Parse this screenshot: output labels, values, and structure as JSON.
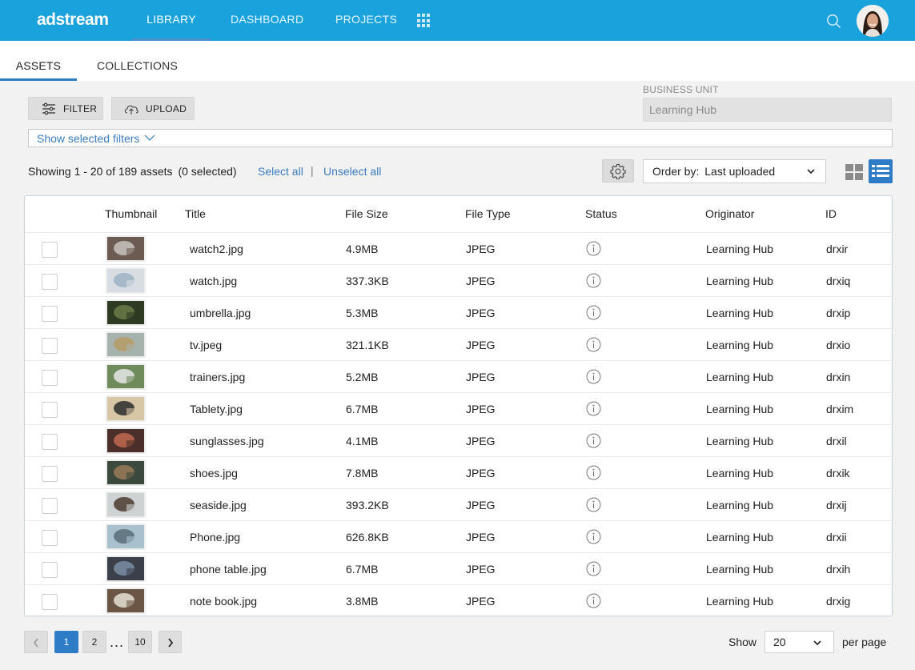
{
  "header": {
    "logo": "adstream",
    "nav": [
      "LIBRARY",
      "DASHBOARD",
      "PROJECTS"
    ],
    "active_nav": "LIBRARY"
  },
  "subtabs": [
    "ASSETS",
    "COLLECTIONS"
  ],
  "toolbar": {
    "filter_label": "FILTER",
    "upload_label": "UPLOAD",
    "business_unit_label": "BUSINESS UNIT",
    "business_unit_value": "Learning Hub",
    "show_filters_label": "Show selected filters"
  },
  "results": {
    "showing": "Showing 1 - 20 of 189 assets",
    "selected": "(0 selected)",
    "select_all": "Select all",
    "separator": "|",
    "unselect_all": "Unselect all",
    "order_by_label": "Order by:",
    "order_by_value": "Last uploaded"
  },
  "table": {
    "columns": [
      "Thumbnail",
      "Title",
      "File Size",
      "File Type",
      "Status",
      "Originator",
      "ID"
    ],
    "rows": [
      {
        "title": "watch2.jpg",
        "size": "4.9MB",
        "type": "JPEG",
        "originator": "Learning Hub",
        "id": "drxir"
      },
      {
        "title": "watch.jpg",
        "size": "337.3KB",
        "type": "JPEG",
        "originator": "Learning Hub",
        "id": "drxiq"
      },
      {
        "title": "umbrella.jpg",
        "size": "5.3MB",
        "type": "JPEG",
        "originator": "Learning Hub",
        "id": "drxip"
      },
      {
        "title": "tv.jpeg",
        "size": "321.1KB",
        "type": "JPEG",
        "originator": "Learning Hub",
        "id": "drxio"
      },
      {
        "title": "trainers.jpg",
        "size": "5.2MB",
        "type": "JPEG",
        "originator": "Learning Hub",
        "id": "drxin"
      },
      {
        "title": "Tablety.jpg",
        "size": "6.7MB",
        "type": "JPEG",
        "originator": "Learning Hub",
        "id": "drxim"
      },
      {
        "title": "sunglasses.jpg",
        "size": "4.1MB",
        "type": "JPEG",
        "originator": "Learning Hub",
        "id": "drxil"
      },
      {
        "title": "shoes.jpg",
        "size": "7.8MB",
        "type": "JPEG",
        "originator": "Learning Hub",
        "id": "drxik"
      },
      {
        "title": "seaside.jpg",
        "size": "393.2KB",
        "type": "JPEG",
        "originator": "Learning Hub",
        "id": "drxij"
      },
      {
        "title": "Phone.jpg",
        "size": "626.8KB",
        "type": "JPEG",
        "originator": "Learning Hub",
        "id": "drxii"
      },
      {
        "title": "phone table.jpg",
        "size": "6.7MB",
        "type": "JPEG",
        "originator": "Learning Hub",
        "id": "drxih"
      },
      {
        "title": "note book.jpg",
        "size": "3.8MB",
        "type": "JPEG",
        "originator": "Learning Hub",
        "id": "drxig"
      }
    ]
  },
  "pagination": {
    "pages": [
      "1",
      "2",
      "10"
    ],
    "current": "1",
    "ellipsis": "...",
    "show_label": "Show",
    "per_page_value": "20",
    "per_page_label": "per page"
  },
  "colors": {
    "topbar": "#1aa2dd",
    "accent": "#2f7cc6",
    "link": "#3b7bbf"
  }
}
